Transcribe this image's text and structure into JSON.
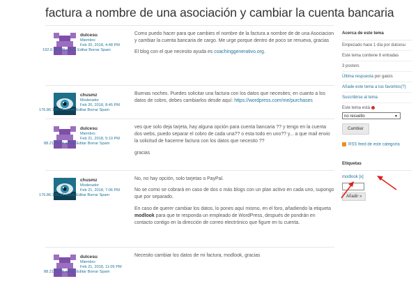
{
  "page": {
    "title": "factura a nombre de una asociación y cambiar la cuenta bancaria"
  },
  "posts": [
    {
      "author": "dulcesu",
      "role": "Miembro",
      "date": "Feb 20, 2018, 4:48 PM",
      "ip_line": "192.0.99.245 whois Editar Borrar Spam",
      "paragraphs": [
        "Como puedo hacer para que cambies el nombre de la factura a nombre de de una Asociacion y cambiar la cuenta bancaria de cargo. Me urge porque dentro de poco se renueva, gracias",
        "El blog con el que necesito ayuda es "
      ],
      "link": "coachinggenerativo.org",
      "link_suffix": "."
    },
    {
      "author": "chusmz",
      "role": "Moderador",
      "date": "Feb 20, 2018, 8:45 PM",
      "ip_line": "176.86.109.25 whois Editar Borrar Spam",
      "paragraphs": [
        "Buenas noches. Puedes solicitar una factura con los datos que necesites; en cuanto a los datos de cobro, debes cambiarlos desde aquí: "
      ],
      "link": "https://wordpress.com/me/purchases"
    },
    {
      "author": "dulcesu",
      "role": "Miembro",
      "date": "Feb 21, 2018, 5:10 PM",
      "ip_line": "88.21.116.6 whois Editar Borrar Spam",
      "paragraphs": [
        "veo que solo deja tarjeta, hay alguna opción para cuenta bancaria ?? y tengo en la cuenta dos webs, puedo separar el cobro de cada una?? o esta todo en uno?? y... a que mail envio la solicitud de hacerme factura con los datos que necesito ??",
        "gracias"
      ]
    },
    {
      "author": "chusmz",
      "role": "Moderador",
      "date": "Feb 21, 2018, 7:06 PM",
      "ip_line": "176.86.109.25 whois Editar Borrar Spam",
      "paragraphs": [
        "No, no hay opción, solo tarjetas o PayPal.",
        "No se como se cobrará en caso de dos o más blogs con un plan activo en cada uno, supongo que por separado."
      ],
      "p3_before": "En caso de querer cambiar los datos, lo pones aquí mismo, en el foro, añadiendo la etiqueta ",
      "p3_bold": "modlook",
      "p3_after": " para que te responda un empleado de WordPress, después de pondrán en contacto contigo en la dirección de correo electrónico que figure en tu cuenta."
    },
    {
      "author": "dulcesu",
      "role": "Miembro",
      "date": "Feb 21, 2018, 11:05 PM",
      "ip_line": "88.21.116.6 whois Editar Borrar Spam",
      "paragraphs": [
        "Necesito cambiar los datos de mi factura, modlook, gracias"
      ]
    }
  ],
  "sidebar": {
    "about_heading": "Acerca de este tema",
    "started": "Empezado hace 1 día por dulcesu",
    "entries": "Este tema contiene 6 entradas",
    "posters": "3 posters",
    "last_reply_link": "Última respuesta",
    "last_reply_suffix": " por gaiois",
    "favorite_link": "Añade este tema a tus favoritos(?)",
    "subscribe_link": "Suscribirse al tema",
    "status_label": "Este tema está",
    "status_value": "no resuelto",
    "change_button": "Cambiar",
    "rss_link": "RSS feed de este categoría",
    "tags_heading": "Etiquetas",
    "tag": "modlook",
    "tag_remove": "[x]",
    "add_button": "Añadir »"
  },
  "colors": {
    "link": "#21759b",
    "annotation_arrow": "#e0201b",
    "status_dot": "#d2322d"
  }
}
